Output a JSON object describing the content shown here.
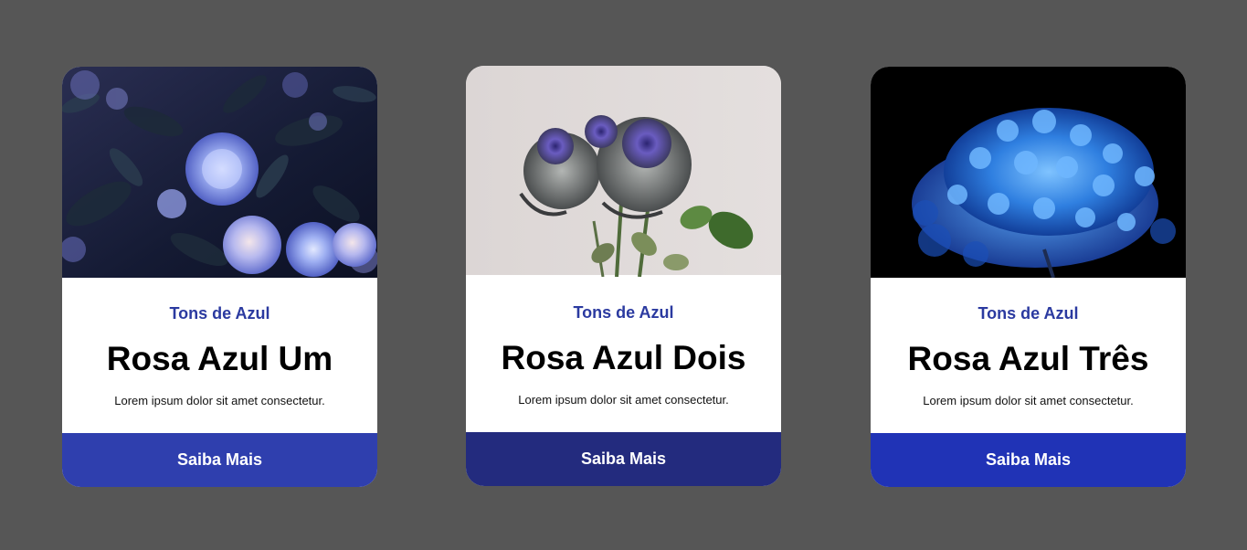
{
  "cards": [
    {
      "eyebrow": "Tons de Azul",
      "title": "Rosa Azul Um",
      "description": "Lorem ipsum dolor sit amet consectetur.",
      "button_label": "Saiba Mais",
      "button_color": "#2f3fae",
      "image_icon": "blue-roses-photo"
    },
    {
      "eyebrow": "Tons de Azul",
      "title": "Rosa Azul Dois",
      "description": "Lorem ipsum dolor sit amet consectetur.",
      "button_label": "Saiba Mais",
      "button_color": "#232b7e",
      "image_icon": "grey-purple-roses-photo"
    },
    {
      "eyebrow": "Tons de Azul",
      "title": "Rosa Azul Três",
      "description": "Lorem ipsum dolor sit amet consectetur.",
      "button_label": "Saiba Mais",
      "button_color": "#2033b6",
      "image_icon": "blue-hydrangea-photo"
    }
  ],
  "colors": {
    "page_background": "#565656",
    "eyebrow_text": "#2b3aa0",
    "card_background": "#ffffff"
  }
}
